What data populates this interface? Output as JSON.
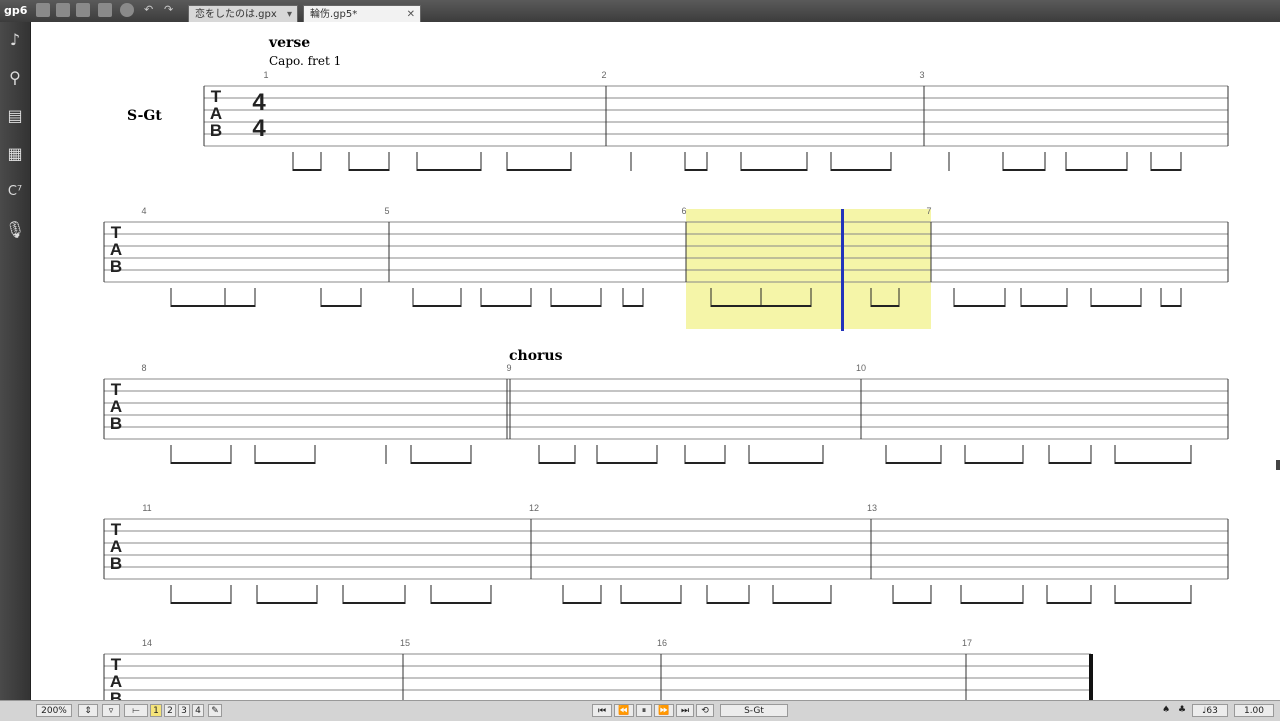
{
  "app": {
    "logo": "gp6"
  },
  "tabs": [
    {
      "label": "恋をしたのは.gpx",
      "active": false
    },
    {
      "label": "輪伤.gp5*",
      "active": true
    }
  ],
  "score": {
    "section_verse": "verse",
    "capo": "Capo. fret 1",
    "track_name": "S-Gt",
    "section_chorus": "chorus",
    "time_signature": "4/4",
    "bar_numbers": [
      "1",
      "2",
      "3",
      "4",
      "5",
      "6",
      "7",
      "8",
      "9",
      "10",
      "11",
      "12",
      "13",
      "14",
      "15",
      "16",
      "17"
    ],
    "tab_letters": [
      "T",
      "A",
      "B"
    ]
  },
  "bottom": {
    "zoom": "200%",
    "voices": [
      "1",
      "2",
      "3",
      "4"
    ],
    "track": "S-Gt",
    "bpm": "63",
    "speed": "1.00"
  },
  "colors": {
    "selection": "#f5f5a8",
    "cursor": "#2233bb",
    "chrome": "#3c3c3c"
  }
}
